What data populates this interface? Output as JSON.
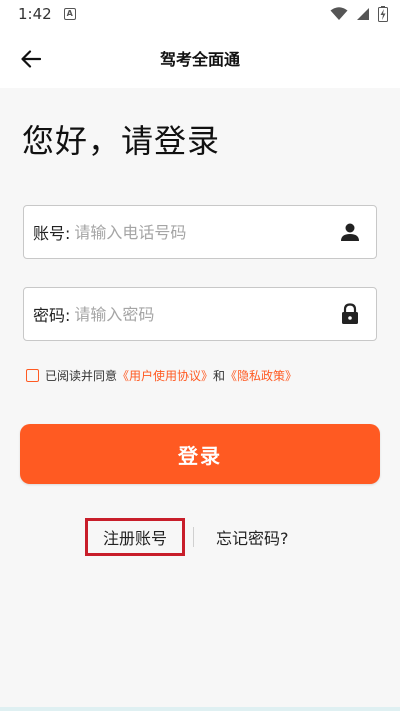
{
  "status_bar": {
    "time": "1:42",
    "notification_badge": "A"
  },
  "app_bar": {
    "title": "驾考全面通"
  },
  "login": {
    "greeting": "您好，请登录",
    "account_label": "账号:",
    "account_placeholder": "请输入电话号码",
    "password_label": "密码:",
    "password_placeholder": "请输入密码",
    "agree_prefix": "已阅读并同意",
    "user_agreement": "《用户使用协议》",
    "agree_and": "和",
    "privacy_policy": "《隐私政策》",
    "login_button": "登录",
    "register_link": "注册账号",
    "forgot_link": "忘记密码?"
  },
  "colors": {
    "accent": "#ff5a22",
    "highlight_border": "#c81e2a"
  },
  "icons": {
    "back": "arrow-left-icon",
    "account": "person-icon",
    "password": "lock-icon",
    "wifi": "wifi-icon",
    "signal": "signal-icon",
    "battery": "battery-icon"
  }
}
